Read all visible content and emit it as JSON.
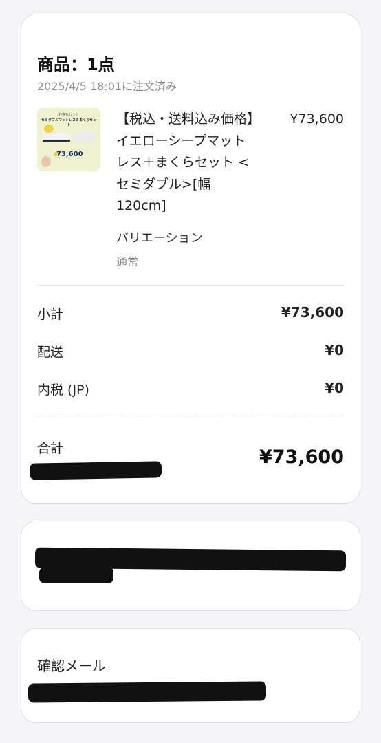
{
  "order": {
    "title": "商品：1点",
    "date": "2025/4/5 18:01に注文済み",
    "item": {
      "name": "【税込・送料込み価格】イエローシープマットレス＋まくらセット <セミダブル>[幅120cm]",
      "price": "¥73,600",
      "variation_label": "バリエーション",
      "variation_value": "通常",
      "thumbnail": {
        "top_text": "お得なセット",
        "headline": "セミダブルマットレス＆まくらセット",
        "price_text": "73,600"
      }
    },
    "summary": [
      {
        "label": "小計",
        "value": "¥73,600"
      },
      {
        "label": "配送",
        "value": "¥0"
      },
      {
        "label": "内税 (JP)",
        "value": "¥0"
      }
    ],
    "total": {
      "label": "合計",
      "value": "¥73,600"
    }
  },
  "email": {
    "label": "確認メール"
  }
}
